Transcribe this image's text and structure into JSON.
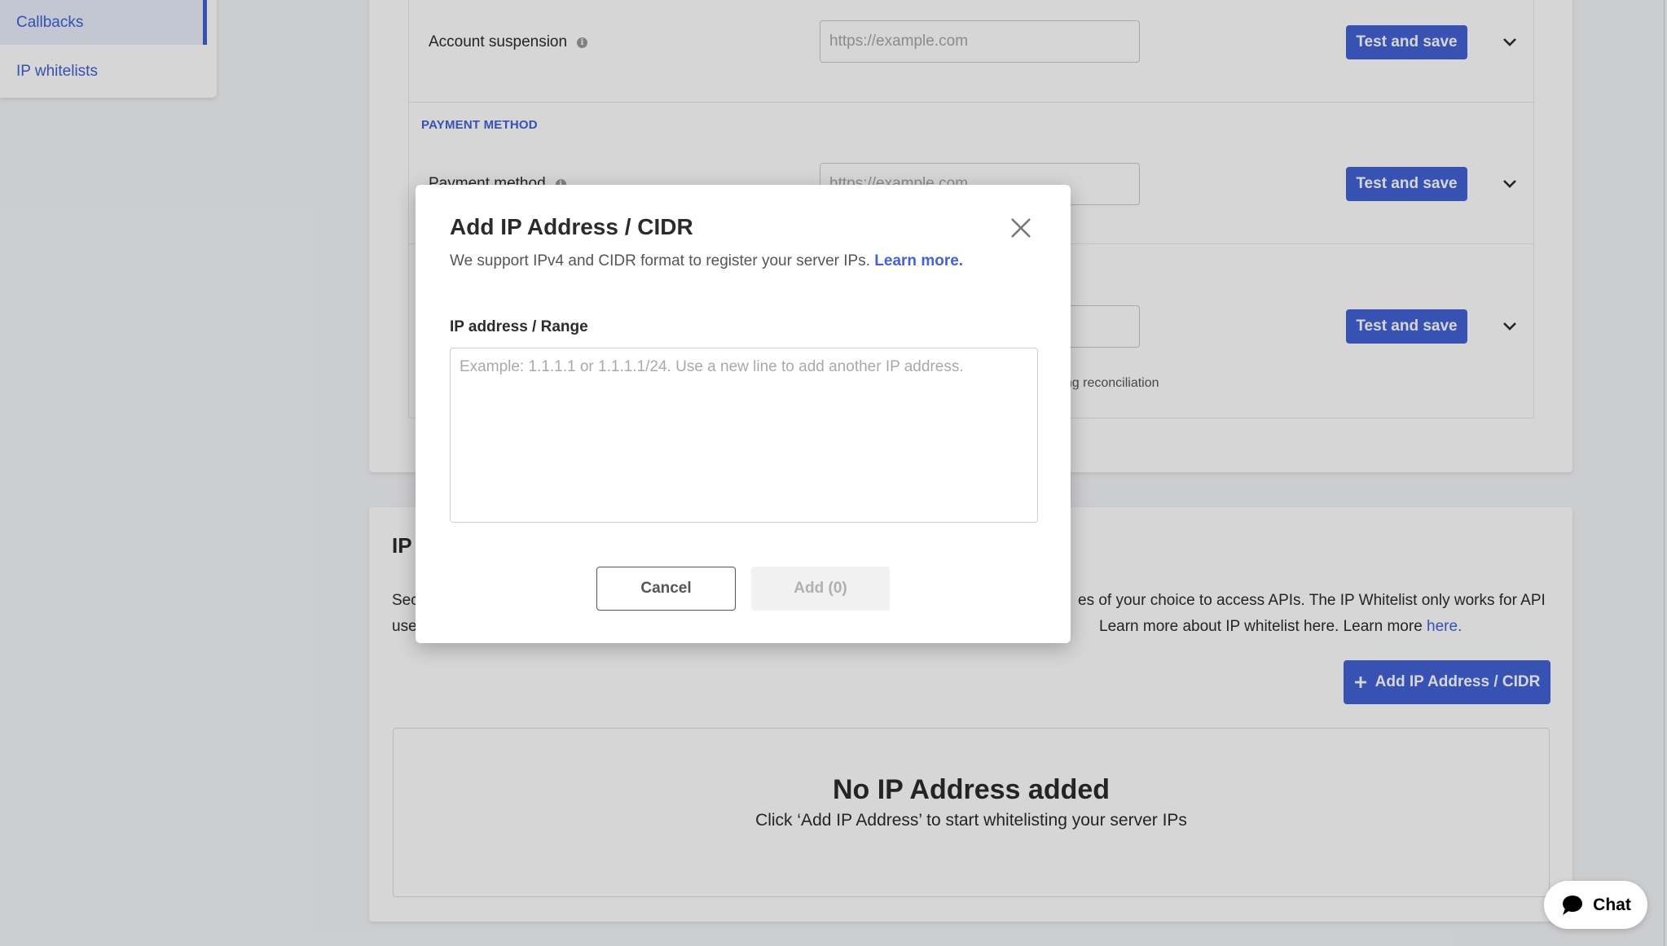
{
  "sidebar": {
    "items": [
      {
        "label": "Callbacks",
        "active": true
      },
      {
        "label": "IP whitelists",
        "active": false
      }
    ]
  },
  "callbacks": {
    "rows": [
      {
        "label": "Account suspension",
        "placeholder": "https://example.com",
        "button": "Test and save"
      },
      {
        "section": "PAYMENT METHOD",
        "label": "Payment method",
        "placeholder": "https://example.com",
        "button": "Test and save"
      },
      {
        "label": "",
        "placeholder": "https://example.com",
        "button": "Test and save",
        "helper_visible": "ring reconciliation"
      }
    ]
  },
  "ip_whitelist": {
    "title_visible": "IP",
    "desc_line1_left": "Sec",
    "desc_line1_right": "es of your choice to access APIs. The IP Whitelist only works for API",
    "desc_line2_left": "use",
    "desc_line2_right": "Learn more about IP whitelist here. Learn more ",
    "desc_link": "here.",
    "add_button": "Add IP Address / CIDR",
    "empty_title": "No IP Address added",
    "empty_subtitle": "Click ‘Add IP Address’ to start whitelisting your server IPs"
  },
  "modal": {
    "title": "Add IP Address / CIDR",
    "subtitle": "We support IPv4 and CIDR format to register your server IPs. ",
    "learn_more": "Learn more.",
    "field_label": "IP address / Range",
    "textarea_placeholder": "Example: 1.1.1.1 or 1.1.1.1/24. Use a new line to add another IP address.",
    "textarea_value": "",
    "cancel": "Cancel",
    "add": "Add (0)"
  },
  "chat": {
    "label": "Chat"
  },
  "colors": {
    "accent": "#4262d6",
    "overlay": "rgba(0,0,0,0.16)",
    "disabled_bg": "#f1f1f1"
  }
}
